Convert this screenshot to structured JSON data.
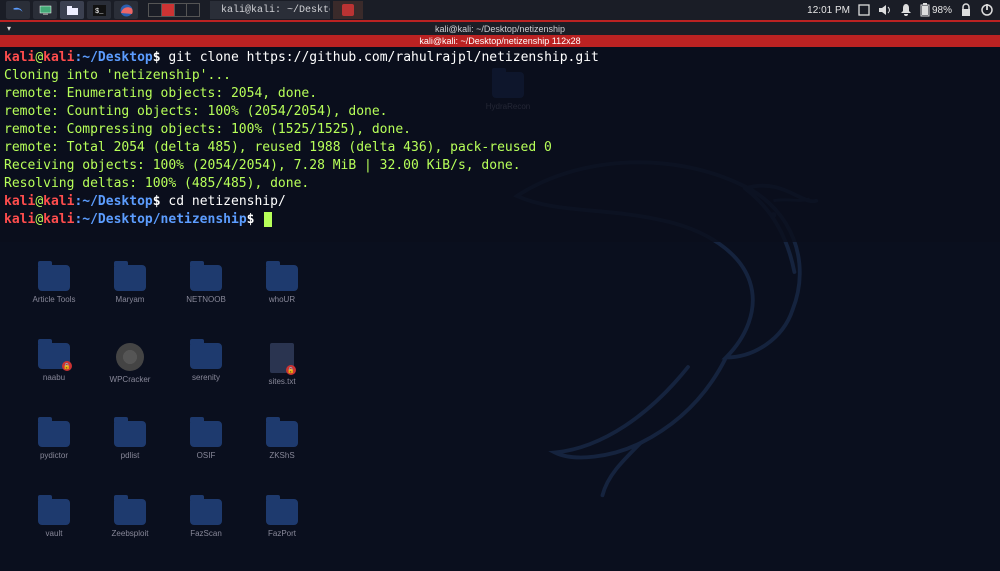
{
  "panel": {
    "clock": "12:01 PM",
    "battery": "98%",
    "taskbar_items": [
      {
        "label": "kali@kali: ~/Desktop/ne...",
        "icon": "terminal-red"
      },
      {
        "label": "",
        "icon": "terminal-red-only"
      }
    ]
  },
  "terminal": {
    "titlebar": "kali@kali: ~/Desktop/netizenship",
    "tab": "kali@kali: ~/Desktop/netizenship 112x28",
    "lines": [
      {
        "type": "prompt",
        "user": "kali",
        "host": "kali",
        "path": "~/Desktop",
        "cmd": "git clone https://github.com/rahulrajpl/netizenship.git"
      },
      {
        "type": "out",
        "text": "Cloning into 'netizenship'..."
      },
      {
        "type": "out",
        "text": "remote: Enumerating objects: 2054, done."
      },
      {
        "type": "out",
        "text": "remote: Counting objects: 100% (2054/2054), done."
      },
      {
        "type": "out",
        "text": "remote: Compressing objects: 100% (1525/1525), done."
      },
      {
        "type": "out",
        "text": "remote: Total 2054 (delta 485), reused 1988 (delta 436), pack-reused 0"
      },
      {
        "type": "out",
        "text": "Receiving objects: 100% (2054/2054), 7.28 MiB | 32.00 KiB/s, done."
      },
      {
        "type": "out",
        "text": "Resolving deltas: 100% (485/485), done."
      },
      {
        "type": "prompt",
        "user": "kali",
        "host": "kali",
        "path": "~/Desktop",
        "cmd": "cd netizenship/"
      },
      {
        "type": "prompt",
        "user": "kali",
        "host": "kali",
        "path": "~/Desktop/netizenship",
        "cmd": "",
        "cursor": true
      }
    ]
  },
  "desktop": {
    "above_row": [
      {
        "label": "HydraRecon",
        "kind": "folder"
      }
    ],
    "icons": [
      {
        "label": "Article Tools",
        "kind": "folder"
      },
      {
        "label": "Maryam",
        "kind": "folder"
      },
      {
        "label": "NETNOOB",
        "kind": "folder"
      },
      {
        "label": "whoUR",
        "kind": "folder"
      },
      {
        "label": "naabu",
        "kind": "folder",
        "lock": true
      },
      {
        "label": "WPCracker",
        "kind": "gear"
      },
      {
        "label": "serenity",
        "kind": "folder"
      },
      {
        "label": "sites.txt",
        "kind": "file",
        "lock": true
      },
      {
        "label": "pydictor",
        "kind": "folder"
      },
      {
        "label": "pdlist",
        "kind": "folder"
      },
      {
        "label": "OSIF",
        "kind": "folder"
      },
      {
        "label": "ZKShS",
        "kind": "folder"
      },
      {
        "label": "vault",
        "kind": "folder"
      },
      {
        "label": "Zeebsploit",
        "kind": "folder"
      },
      {
        "label": "FazScan",
        "kind": "folder"
      },
      {
        "label": "FazPort",
        "kind": "folder"
      }
    ]
  }
}
